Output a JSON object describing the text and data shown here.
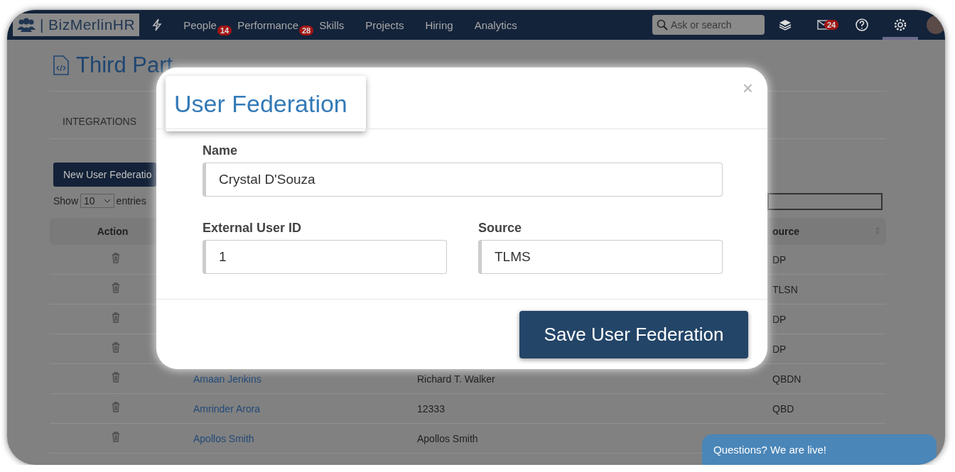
{
  "nav": {
    "logo_separator": "|",
    "logo": "BizMerlinHR",
    "items": [
      {
        "label": "People",
        "badge": "14",
        "selected": false
      },
      {
        "label": "Performance",
        "badge": "28",
        "selected": false
      },
      {
        "label": "Skills",
        "selected": false
      },
      {
        "label": "Projects",
        "selected": false
      },
      {
        "label": "Hiring",
        "selected": false
      },
      {
        "label": "Analytics",
        "selected": false
      }
    ],
    "search": {
      "placeholder": "Ask or search"
    },
    "mail_badge": "24",
    "settings_selected": true
  },
  "page": {
    "title": "Third Part",
    "tabs": [
      {
        "label": "INTEGRATIONS",
        "selected": false
      }
    ],
    "new_button": "New User Federatio",
    "show_label": "Show",
    "page_size": "10",
    "entries_label": "entries",
    "table": {
      "columns": [
        "Action",
        "ource"
      ],
      "rows": [
        {
          "source": "DP"
        },
        {
          "source": "TLSN"
        },
        {
          "source": "DP"
        },
        {
          "source": "DP"
        },
        {
          "name": "Amaan Jenkins",
          "external_id": "Richard T. Walker",
          "source": "QBDN"
        },
        {
          "name": "Amrinder Arora",
          "external_id": "12333",
          "source": "QBD"
        },
        {
          "name": "Apollos Smith",
          "external_id": "Apollos Smith"
        }
      ]
    }
  },
  "modal": {
    "title": "User Federation",
    "close": "×",
    "fields": [
      {
        "label": "Name",
        "value": "Crystal D'Souza"
      },
      {
        "label": "External User ID",
        "value": "1"
      },
      {
        "label": "Source",
        "value": "TLMS"
      }
    ],
    "save_button": "Save User Federation"
  },
  "chat": {
    "label": "Questions? We are live!"
  }
}
